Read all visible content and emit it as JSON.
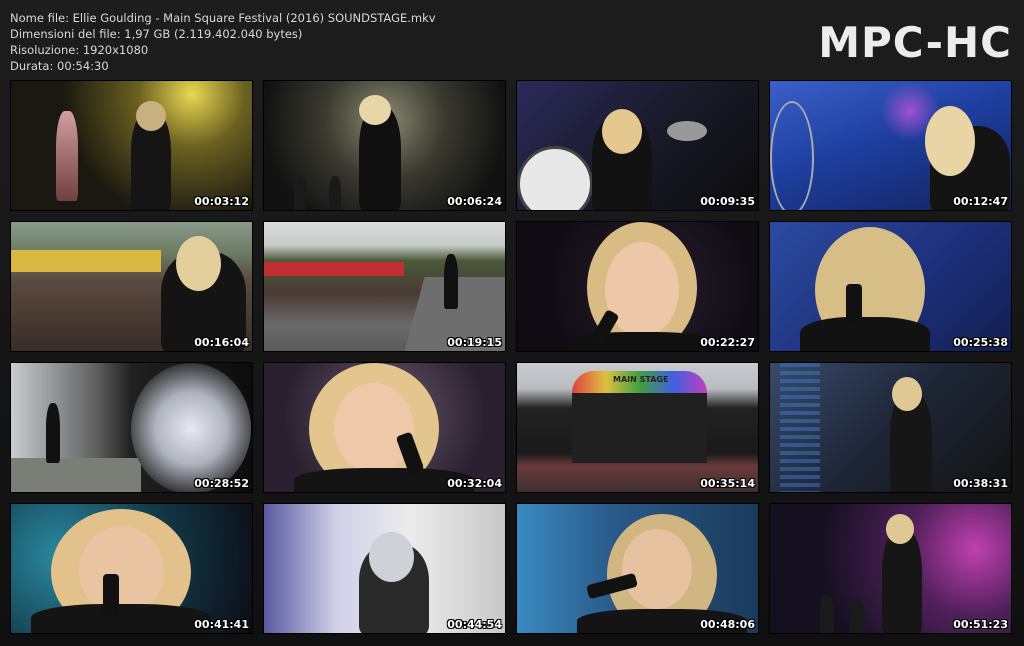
{
  "file_info": {
    "name_line": "Nome file: Ellie Goulding - Main Square Festival (2016) SOUNDSTAGE.mkv",
    "size_line": "Dimensioni del file: 1,97 GB (2.119.402.040 bytes)",
    "resolution_line": "Risoluzione: 1920x1080",
    "duration_line": "Durata: 00:54:30"
  },
  "logo": "MPC-HC",
  "stage_sign": "MAIN STAGE",
  "thumbnails": [
    {
      "time": "00:03:12"
    },
    {
      "time": "00:06:24"
    },
    {
      "time": "00:09:35"
    },
    {
      "time": "00:12:47"
    },
    {
      "time": "00:16:04"
    },
    {
      "time": "00:19:15"
    },
    {
      "time": "00:22:27"
    },
    {
      "time": "00:25:38"
    },
    {
      "time": "00:28:52"
    },
    {
      "time": "00:32:04"
    },
    {
      "time": "00:35:14"
    },
    {
      "time": "00:38:31"
    },
    {
      "time": "00:41:41"
    },
    {
      "time": "00:44:54"
    },
    {
      "time": "00:48:06"
    },
    {
      "time": "00:51:23"
    }
  ]
}
